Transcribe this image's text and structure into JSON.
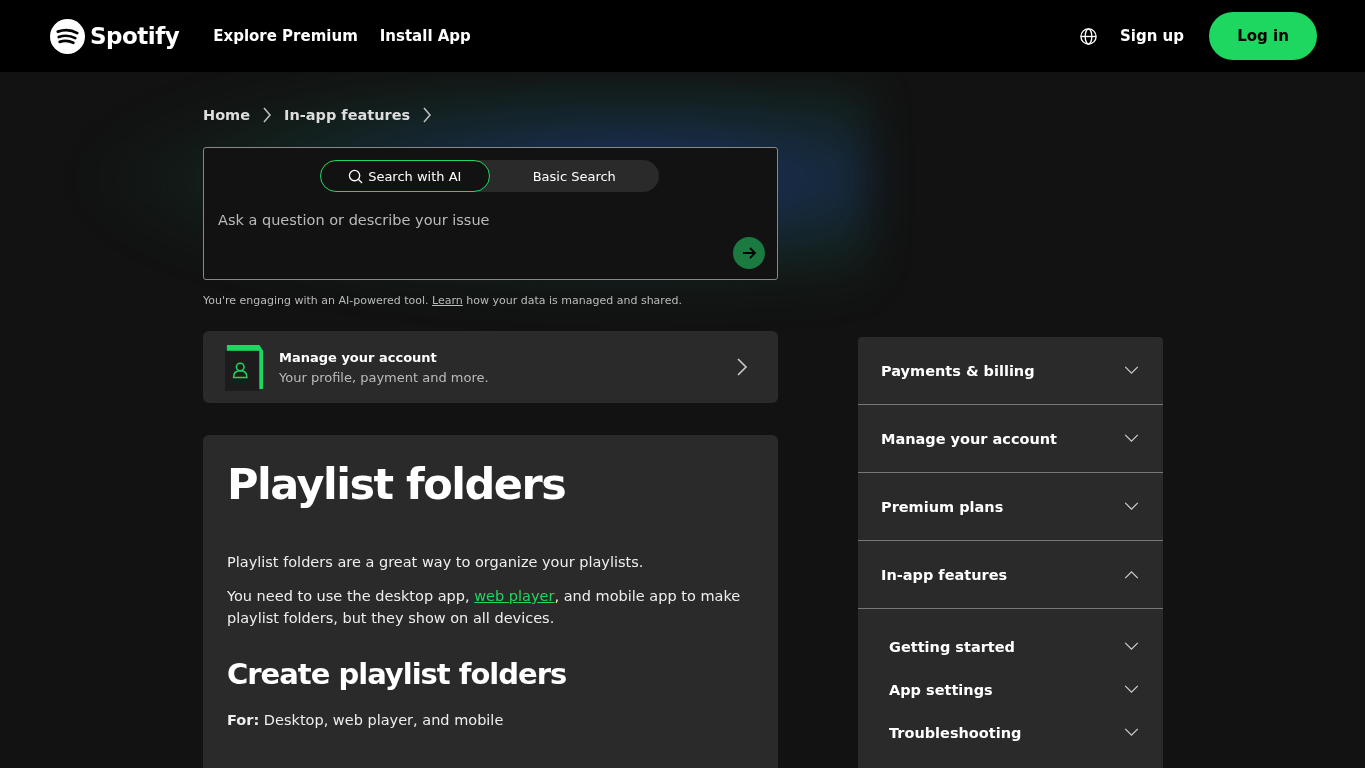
{
  "header": {
    "logo": "Spotify",
    "nav": [
      "Explore Premium",
      "Install App"
    ],
    "signup": "Sign up",
    "login": "Log in"
  },
  "breadcrumbs": [
    "Home",
    "In-app features"
  ],
  "search": {
    "modes": [
      {
        "label": "Search with AI",
        "selected": true
      },
      {
        "label": "Basic Search",
        "selected": false
      }
    ],
    "placeholder": "Ask a question or describe your issue",
    "disclaimer": "You're engaging with an AI-powered tool. ",
    "disclaimer_link": "Learn",
    "disclaimer_rest": " how your data is managed and shared."
  },
  "account_card": {
    "title": "Manage your account",
    "subtitle": "Your profile, payment and more."
  },
  "article": {
    "title": "Playlist folders",
    "intro": "Playlist folders are a great way to organize your playlists.",
    "para_before": "You need to use the desktop app, ",
    "link": "web player",
    "para_after": ", and mobile app to make playlist folders, but they show on all devices.",
    "heading": "Create playlist folders",
    "for": "**For:** Desktop, web player, and mobile"
  },
  "sidebar": {
    "items": [
      {
        "label": "Payments & billing",
        "expanded": false
      },
      {
        "label": "Manage your account",
        "expanded": false
      },
      {
        "label": "Premium plans",
        "expanded": false
      },
      {
        "label": "In-app features",
        "expanded": true,
        "children": [
          {
            "label": "Getting started",
            "expanded": false
          },
          {
            "label": "App settings",
            "expanded": false
          },
          {
            "label": "Troubleshooting",
            "expanded": false
          }
        ]
      }
    ]
  }
}
